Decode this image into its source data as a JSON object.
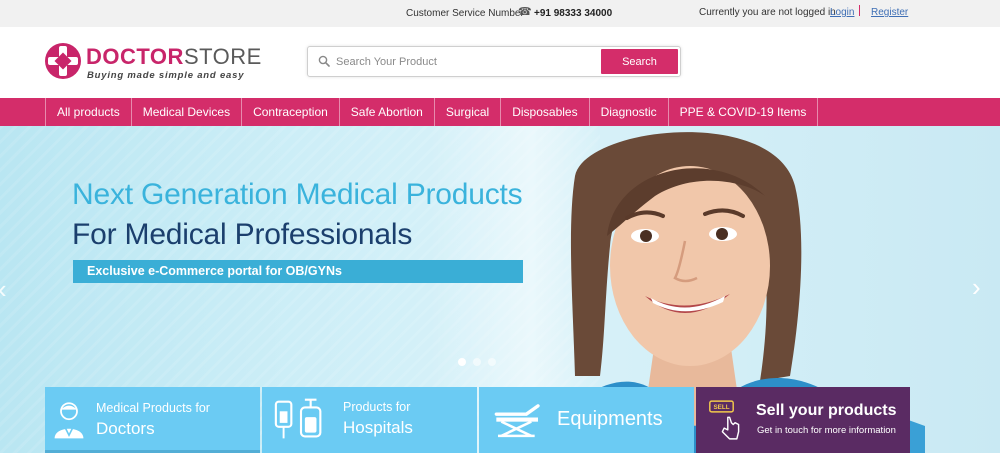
{
  "topbar": {
    "customer_service_label": "Customer Service Number",
    "phone": "+91 98333 34000",
    "login_status": "Currently you are not logged in",
    "login_label": "Login",
    "register_label": "Register"
  },
  "header": {
    "logo_doctor": "DOCTOR",
    "logo_store": "STORE",
    "tagline": "Buying made simple and easy",
    "search_placeholder": "Search Your Product",
    "search_button": "Search"
  },
  "nav": {
    "items": [
      "All products",
      "Medical Devices",
      "Contraception",
      "Safe Abortion",
      "Surgical",
      "Disposables",
      "Diagnostic",
      "PPE & COVID-19 Items"
    ]
  },
  "hero": {
    "title_line1": "Next Generation Medical Products",
    "title_line2": "For Medical Professionals",
    "ribbon": "Exclusive e-Commerce portal for OB/GYNs",
    "slides_total": 3,
    "slide_active": 1
  },
  "tiles": {
    "doctors": {
      "small": "Medical Products for",
      "big": "Doctors",
      "icon": "doctor-icon"
    },
    "hospitals": {
      "small": "Products for",
      "big": "Hospitals",
      "icon": "iv-drip-icon"
    },
    "equipments": {
      "big": "Equipments",
      "icon": "hospital-bed-icon"
    },
    "sell": {
      "big": "Sell your products",
      "small": "Get in touch for more information",
      "icon": "sell-tag-icon"
    }
  },
  "colors": {
    "brand_pink": "#d42d6a",
    "logo_pink": "#c8256a",
    "hero_blue": "#3ab3dc",
    "hero_navy": "#1b3f6d",
    "tile_blue": "#6bcbf3",
    "tile_purple": "#5a2b63",
    "link_blue": "#3f6fb5"
  }
}
